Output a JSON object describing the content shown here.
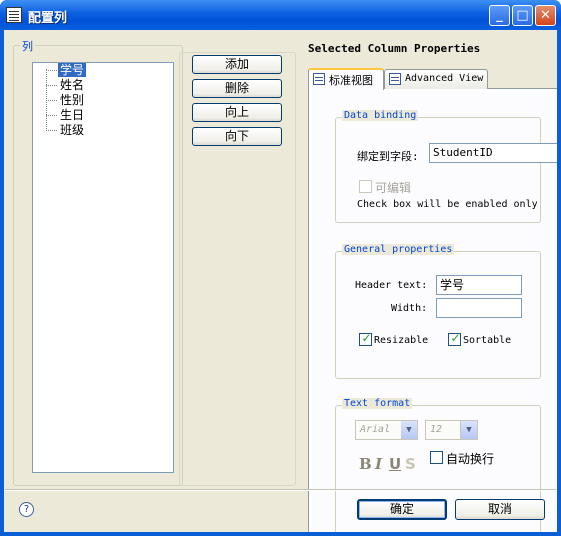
{
  "window": {
    "title": "配置列",
    "minimize_glyph": "_",
    "maximize_glyph": "□",
    "close_glyph": "✕"
  },
  "columns_group": {
    "legend": "列",
    "items": [
      {
        "label": "学号",
        "selected": true
      },
      {
        "label": "姓名",
        "selected": false
      },
      {
        "label": "性别",
        "selected": false
      },
      {
        "label": "生日",
        "selected": false
      },
      {
        "label": "班级",
        "selected": false
      }
    ]
  },
  "column_buttons": {
    "add": "添加",
    "delete": "删除",
    "up": "向上",
    "down": "向下"
  },
  "properties": {
    "title": "Selected Column Properties",
    "tabs": [
      {
        "label": "标准视图",
        "active": true,
        "icon": "grid-view-icon"
      },
      {
        "label": "Advanced View",
        "active": false,
        "icon": "table-view-icon"
      }
    ],
    "data_binding": {
      "legend": "Data binding",
      "field_label": "绑定到字段:",
      "field_value": "StudentID",
      "editable_label": "可编辑",
      "editable_checked": false,
      "note": "Check box will be enabled only"
    },
    "general": {
      "legend": "General properties",
      "header_label": "Header text:",
      "header_value": "学号",
      "width_label": "Width:",
      "width_value": "",
      "resizable_label": "Resizable",
      "resizable_checked": true,
      "sortable_label": "Sortable",
      "sortable_checked": true
    },
    "text_format": {
      "legend": "Text format",
      "font": "Arial",
      "size": "12",
      "bold": "B",
      "italic": "I",
      "underline": "U",
      "strikeout": "S",
      "wrap_label": "自动换行",
      "wrap_checked": false
    }
  },
  "footer": {
    "help": "?",
    "ok": "确定",
    "cancel": "取消"
  },
  "colors": {
    "titlebar": "#0b5fe0",
    "dialog_bg": "#ece9d8",
    "selection": "#316ac5",
    "legend_text": "#0046d5",
    "check_mark": "#21a121"
  }
}
